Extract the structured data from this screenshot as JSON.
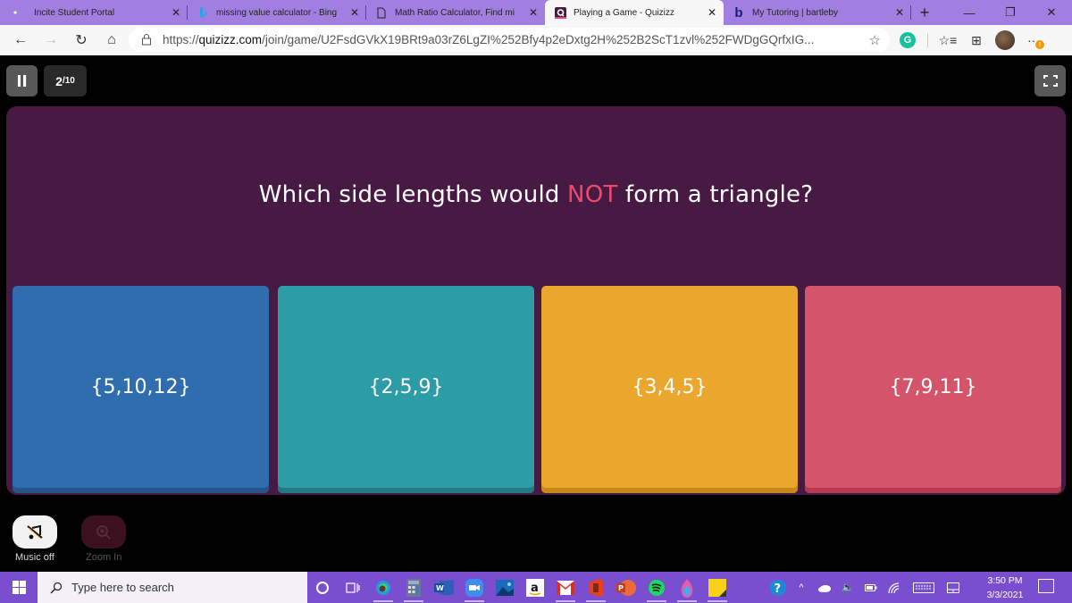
{
  "browser": {
    "tabs": [
      {
        "title": "Incite Student Portal",
        "favicon": "incite-dot-icon",
        "active": false
      },
      {
        "title": "missing value calculator - Bing",
        "favicon": "bing-icon",
        "active": false
      },
      {
        "title": "Math Ratio Calculator, Find mi",
        "favicon": "page-icon",
        "active": false
      },
      {
        "title": "Playing a Game - Quizizz",
        "favicon": "quizizz-icon",
        "active": true
      },
      {
        "title": "My Tutoring | bartleby",
        "favicon": "bartleby-icon",
        "active": false
      }
    ],
    "close_glyph": "✕",
    "new_tab_glyph": "+",
    "window_controls": {
      "minimize": "—",
      "restore": "❐",
      "close": "✕"
    },
    "nav": {
      "back": "←",
      "forward": "→",
      "refresh": "↻",
      "home": "⌂"
    },
    "url": {
      "scheme": "https://",
      "domain": "quizizz.com",
      "path": "/join/game/U2FsdGVkX19BRt9a03rZ6LgZI%252Bfy4p2eDxtg2H%252B2ScT1zvl%252FWDgGQrfxIG..."
    },
    "toolbar_icons": [
      "favorite-add-icon",
      "grammarly-icon",
      "favorites-icon",
      "collections-icon",
      "profile-avatar",
      "more-icon"
    ],
    "grammarly_letter": "G",
    "more_glyph": "···",
    "update_badge": "!"
  },
  "quiz": {
    "progress": {
      "current": "2",
      "total": "/10"
    },
    "question": {
      "before": "Which side lengths would ",
      "emphasis": "NOT",
      "after": " form a triangle?"
    },
    "options": [
      {
        "label": "{5,10,12}",
        "color": "#2f6dae"
      },
      {
        "label": "{2,5,9}",
        "color": "#2c9ca6"
      },
      {
        "label": "{3,4,5}",
        "color": "#eba72d"
      },
      {
        "label": "{7,9,11}",
        "color": "#d4546a"
      }
    ],
    "controls": {
      "music_label": "Music off",
      "zoom_label": "Zoom In"
    },
    "colors": {
      "panel": "#461a42",
      "emphasis": "#ef4a6a"
    }
  },
  "taskbar": {
    "search_placeholder": "Type here to search",
    "apps": [
      "cortana",
      "task-view",
      "edge",
      "calculator",
      "word",
      "zoom",
      "photos",
      "amazon",
      "gmail",
      "office",
      "powerpoint",
      "spotify",
      "paint-3d",
      "sticky-notes",
      "help"
    ],
    "tray": [
      "help-tray",
      "show-hidden",
      "onedrive",
      "volume",
      "battery",
      "wifi",
      "keyboard",
      "touchpad"
    ],
    "time": "3:50 PM",
    "date": "3/3/2021"
  }
}
